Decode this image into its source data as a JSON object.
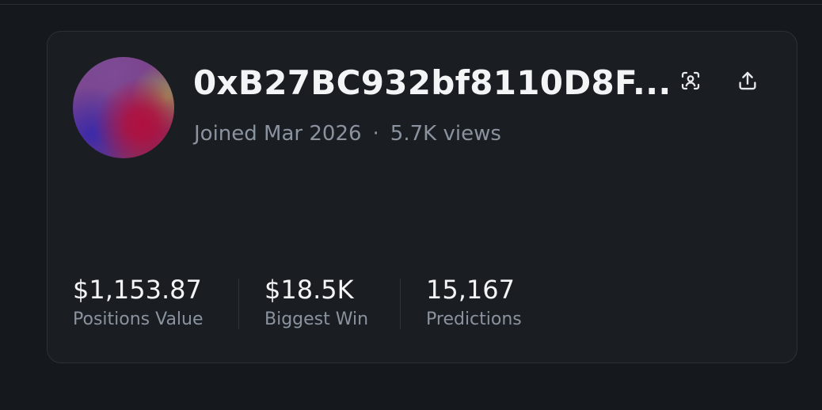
{
  "profile": {
    "handle": "0xB27BC932bf8110D8F...",
    "joined": "Joined Mar 2026",
    "separator": "·",
    "views": "5.7K views"
  },
  "actions": {
    "scan_icon": "scan-profile-icon",
    "share_icon": "share-upload-icon"
  },
  "stats": [
    {
      "value": "$1,153.87",
      "label": "Positions Value"
    },
    {
      "value": "$18.5K",
      "label": "Biggest Win"
    },
    {
      "value": "15,167",
      "label": "Predictions"
    }
  ],
  "colors": {
    "background": "#15181d",
    "card": "#1a1d22",
    "border": "#2c3139",
    "text_primary": "#f3f4f6",
    "text_secondary": "#8a939e"
  }
}
